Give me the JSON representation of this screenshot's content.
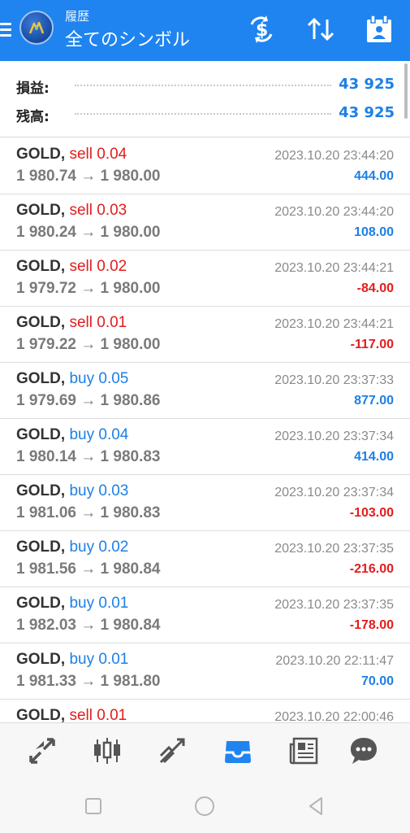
{
  "header": {
    "subtitle": "履歴",
    "title": "全てのシンボル"
  },
  "summary": {
    "profit_label": "損益:",
    "profit_value": "43 925",
    "balance_label": "残高:",
    "balance_value": "43 925"
  },
  "trades": [
    {
      "symbol": "GOLD,",
      "side": "sell",
      "lots": "0.04",
      "open": "1 980.74",
      "close": "1 980.00",
      "time": "2023.10.20 23:44:20",
      "profit": "444.00",
      "sign": "pos"
    },
    {
      "symbol": "GOLD,",
      "side": "sell",
      "lots": "0.03",
      "open": "1 980.24",
      "close": "1 980.00",
      "time": "2023.10.20 23:44:20",
      "profit": "108.00",
      "sign": "pos"
    },
    {
      "symbol": "GOLD,",
      "side": "sell",
      "lots": "0.02",
      "open": "1 979.72",
      "close": "1 980.00",
      "time": "2023.10.20 23:44:21",
      "profit": "-84.00",
      "sign": "neg"
    },
    {
      "symbol": "GOLD,",
      "side": "sell",
      "lots": "0.01",
      "open": "1 979.22",
      "close": "1 980.00",
      "time": "2023.10.20 23:44:21",
      "profit": "-117.00",
      "sign": "neg"
    },
    {
      "symbol": "GOLD,",
      "side": "buy",
      "lots": "0.05",
      "open": "1 979.69",
      "close": "1 980.86",
      "time": "2023.10.20 23:37:33",
      "profit": "877.00",
      "sign": "pos"
    },
    {
      "symbol": "GOLD,",
      "side": "buy",
      "lots": "0.04",
      "open": "1 980.14",
      "close": "1 980.83",
      "time": "2023.10.20 23:37:34",
      "profit": "414.00",
      "sign": "pos"
    },
    {
      "symbol": "GOLD,",
      "side": "buy",
      "lots": "0.03",
      "open": "1 981.06",
      "close": "1 980.83",
      "time": "2023.10.20 23:37:34",
      "profit": "-103.00",
      "sign": "neg"
    },
    {
      "symbol": "GOLD,",
      "side": "buy",
      "lots": "0.02",
      "open": "1 981.56",
      "close": "1 980.84",
      "time": "2023.10.20 23:37:35",
      "profit": "-216.00",
      "sign": "neg"
    },
    {
      "symbol": "GOLD,",
      "side": "buy",
      "lots": "0.01",
      "open": "1 982.03",
      "close": "1 980.84",
      "time": "2023.10.20 23:37:35",
      "profit": "-178.00",
      "sign": "neg"
    },
    {
      "symbol": "GOLD,",
      "side": "buy",
      "lots": "0.01",
      "open": "1 981.33",
      "close": "1 981.80",
      "time": "2023.10.20 22:11:47",
      "profit": "70.00",
      "sign": "pos"
    },
    {
      "symbol": "GOLD,",
      "side": "sell",
      "lots": "0.01",
      "open": "",
      "close": "",
      "time": "2023.10.20 22:00:46",
      "profit": "",
      "sign": "pos"
    }
  ],
  "arrow": "→",
  "header_icons": [
    "currency-exchange-icon",
    "sort-icon",
    "calendar-period-icon"
  ],
  "bottom_nav": [
    "quotes-icon",
    "chart-icon",
    "trade-icon",
    "history-icon",
    "news-icon",
    "chat-icon"
  ],
  "bottom_nav_active": "history-icon",
  "colors": {
    "accent": "#1f84ef",
    "positive": "#1d7fe6",
    "negative": "#e21d1d",
    "inactive_icon": "#555555"
  }
}
